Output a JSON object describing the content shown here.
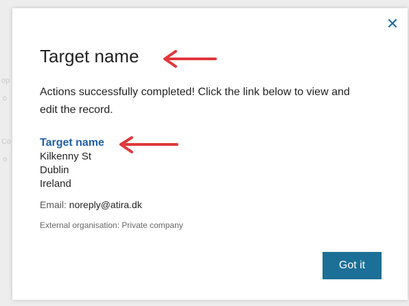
{
  "dialog": {
    "title": "Target name",
    "message": "Actions successfully completed! Click the link below to view and edit the record.",
    "record": {
      "link_text": "Target name",
      "address": [
        "Kilkenny St",
        "Dublin",
        "Ireland"
      ],
      "email_label": "Email: ",
      "email_value": "noreply@atira.dk",
      "org_text": "External organisation: Private company"
    },
    "close_icon": "close-icon",
    "button_label": "Got it"
  },
  "colors": {
    "accent_blue": "#1f5fa8",
    "button_blue": "#1c6f96",
    "annotation_red": "#e0383b"
  }
}
